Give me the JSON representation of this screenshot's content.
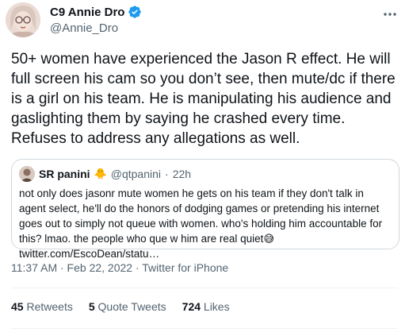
{
  "author": {
    "name": "C9 Annie Dro",
    "handle": "@Annie_Dro"
  },
  "tweet": {
    "text": "50+ women have experienced the Jason R effect. He will full screen his cam so you don’t see, then mute/dc if there is a girl on his team. He is manipulating his audience and gaslighting them by saying he crashed every time. Refuses to address any allegations as well."
  },
  "quote": {
    "name": "SR panini",
    "name_emoji": "🐥",
    "handle": "@qtpanini",
    "sep": "·",
    "age": "22h",
    "text": "not only does jasonr mute women he gets on his team if they don't talk in agent select, he'll do the honors of dodging games or pretending his internet goes out to simply not queue with women. who's holding him accountable for this? lmao. the people who que w him are real quiet",
    "emoji_inline": "😅",
    "link": "twitter.com/EscoDean/statu…"
  },
  "meta": {
    "timestamp": "11:37 AM · Feb 22, 2022 · Twitter for iPhone"
  },
  "stats": {
    "retweets_count": "45",
    "retweets_label": "Retweets",
    "quotes_count": "5",
    "quotes_label": "Quote Tweets",
    "likes_count": "724",
    "likes_label": "Likes"
  },
  "colors": {
    "verified": "#1d9bf0",
    "secondary_text": "#536471",
    "border": "#cfd9de"
  }
}
